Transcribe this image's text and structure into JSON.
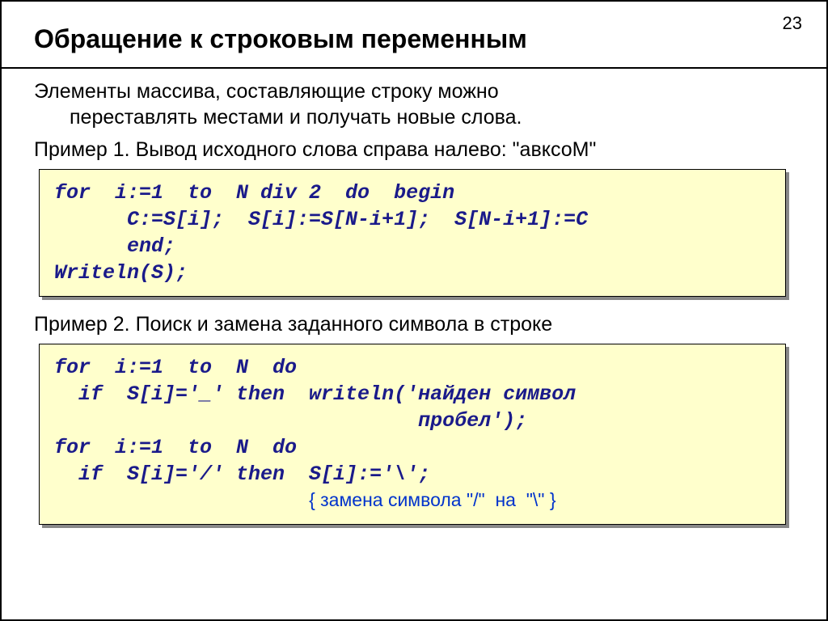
{
  "pageNumber": "23",
  "title": "Обращение к строковым переменным",
  "intro": {
    "line1": "Элементы массива,  составляющие строку можно",
    "line2": "переставлять местами и получать новые слова."
  },
  "example1": {
    "label": "Пример 1. Вывод исходного слова справа налево: \"авксоМ\"",
    "code": "for  i:=1  to  N div 2  do  begin\n      C:=S[i];  S[i]:=S[N-i+1];  S[N-i+1]:=C\n      end;\nWriteln(S);"
  },
  "example2": {
    "label": "Пример 2. Поиск и замена заданного символа в строке",
    "code_pre": "for  i:=1  to  N  do\n  if  S[i]='_' then  writeln('найден символ\n                              пробел');\nfor  i:=1  to  N  do\n  if  S[i]='/' then  S[i]:='\\';\n                     ",
    "comment": "{ замена символа \"/\"  на  \"\\\" }"
  }
}
